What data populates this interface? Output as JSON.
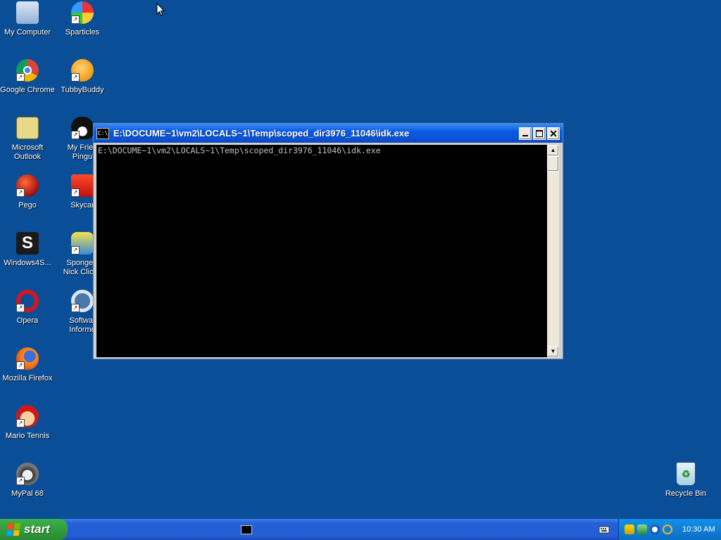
{
  "desktop_icons": [
    {
      "label": "My Computer",
      "icon": "my-computer-icon",
      "shortcut": false
    },
    {
      "label": "Sparticles",
      "icon": "sparticles-icon",
      "shortcut": true
    },
    {
      "label": "Google Chrome",
      "icon": "chrome-icon",
      "shortcut": true
    },
    {
      "label": "TubbyBuddy",
      "icon": "tubbybuddy-icon",
      "shortcut": true
    },
    {
      "label": "Microsoft\nOutlook",
      "icon": "outlook-icon",
      "shortcut": false
    },
    {
      "label": "My Frien\nPingu",
      "icon": "pingu-icon",
      "shortcut": true
    },
    {
      "label": "Pego",
      "icon": "pego-icon",
      "shortcut": true
    },
    {
      "label": "Skycar",
      "icon": "skycar-icon",
      "shortcut": true
    },
    {
      "label": "Windows4S...",
      "icon": "windows4s-icon",
      "shortcut": false
    },
    {
      "label": "SpongeB\nNick Clicka",
      "icon": "spongebob-icon",
      "shortcut": true
    },
    {
      "label": "Opera",
      "icon": "opera-icon",
      "shortcut": true
    },
    {
      "label": "Softwar\nInforme",
      "icon": "software-informer-icon",
      "shortcut": true
    },
    {
      "label": "Mozilla Firefox",
      "icon": "firefox-icon",
      "shortcut": true
    },
    {
      "label": "Mario Tennis",
      "icon": "mario-tennis-icon",
      "shortcut": true
    },
    {
      "label": "MyPal 68",
      "icon": "mypal-icon",
      "shortcut": true
    },
    {
      "label": "Recycle Bin",
      "icon": "recycle-bin-icon",
      "shortcut": false
    }
  ],
  "window": {
    "title": "E:\\DOCUME~1\\vm2\\LOCALS~1\\Temp\\scoped_dir3976_11046\\idk.exe",
    "app_icon": "C:\\",
    "console_text": "E:\\DOCUME~1\\vm2\\LOCALS~1\\Temp\\scoped_dir3976_11046\\idk.exe",
    "close_glyph": "✕"
  },
  "taskbar": {
    "start_label": "start",
    "clock": "10:30 AM"
  },
  "colors": {
    "desktop": "#0b4e98",
    "titlebar": "#0a5be0",
    "tray": "#0f7fd8",
    "start": "#2f9a3c"
  }
}
